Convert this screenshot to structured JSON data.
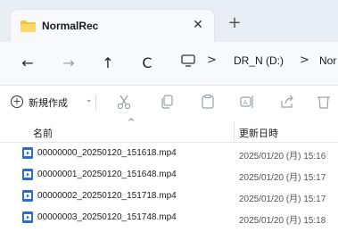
{
  "tab": {
    "title": "NormalRec",
    "close_glyph": "✕",
    "new_tab_glyph": "+"
  },
  "nav": {
    "back_glyph": "←",
    "forward_glyph": "→",
    "up_glyph": "↑",
    "refresh_glyph": "C",
    "chevron": ">",
    "crumbs": [
      "DR_N (D:)",
      "Nor"
    ]
  },
  "toolbar": {
    "new_label": "新規作成",
    "new_caret": "⌄"
  },
  "columns": {
    "name": "名前",
    "modified": "更新日時"
  },
  "files": [
    {
      "name": "00000000_20250120_151618.mp4",
      "modified": "2025/01/20 (月) 15:16"
    },
    {
      "name": "00000001_20250120_151648.mp4",
      "modified": "2025/01/20 (月) 15:17"
    },
    {
      "name": "00000002_20250120_151718.mp4",
      "modified": "2025/01/20 (月) 15:17"
    },
    {
      "name": "00000003_20250120_151748.mp4",
      "modified": "2025/01/20 (月) 15:18"
    }
  ],
  "colors": {
    "tabstrip_bg": "#e9eef6",
    "folder_yellow": "#f4c542",
    "file_icon_blue": "#2b6cd4"
  }
}
